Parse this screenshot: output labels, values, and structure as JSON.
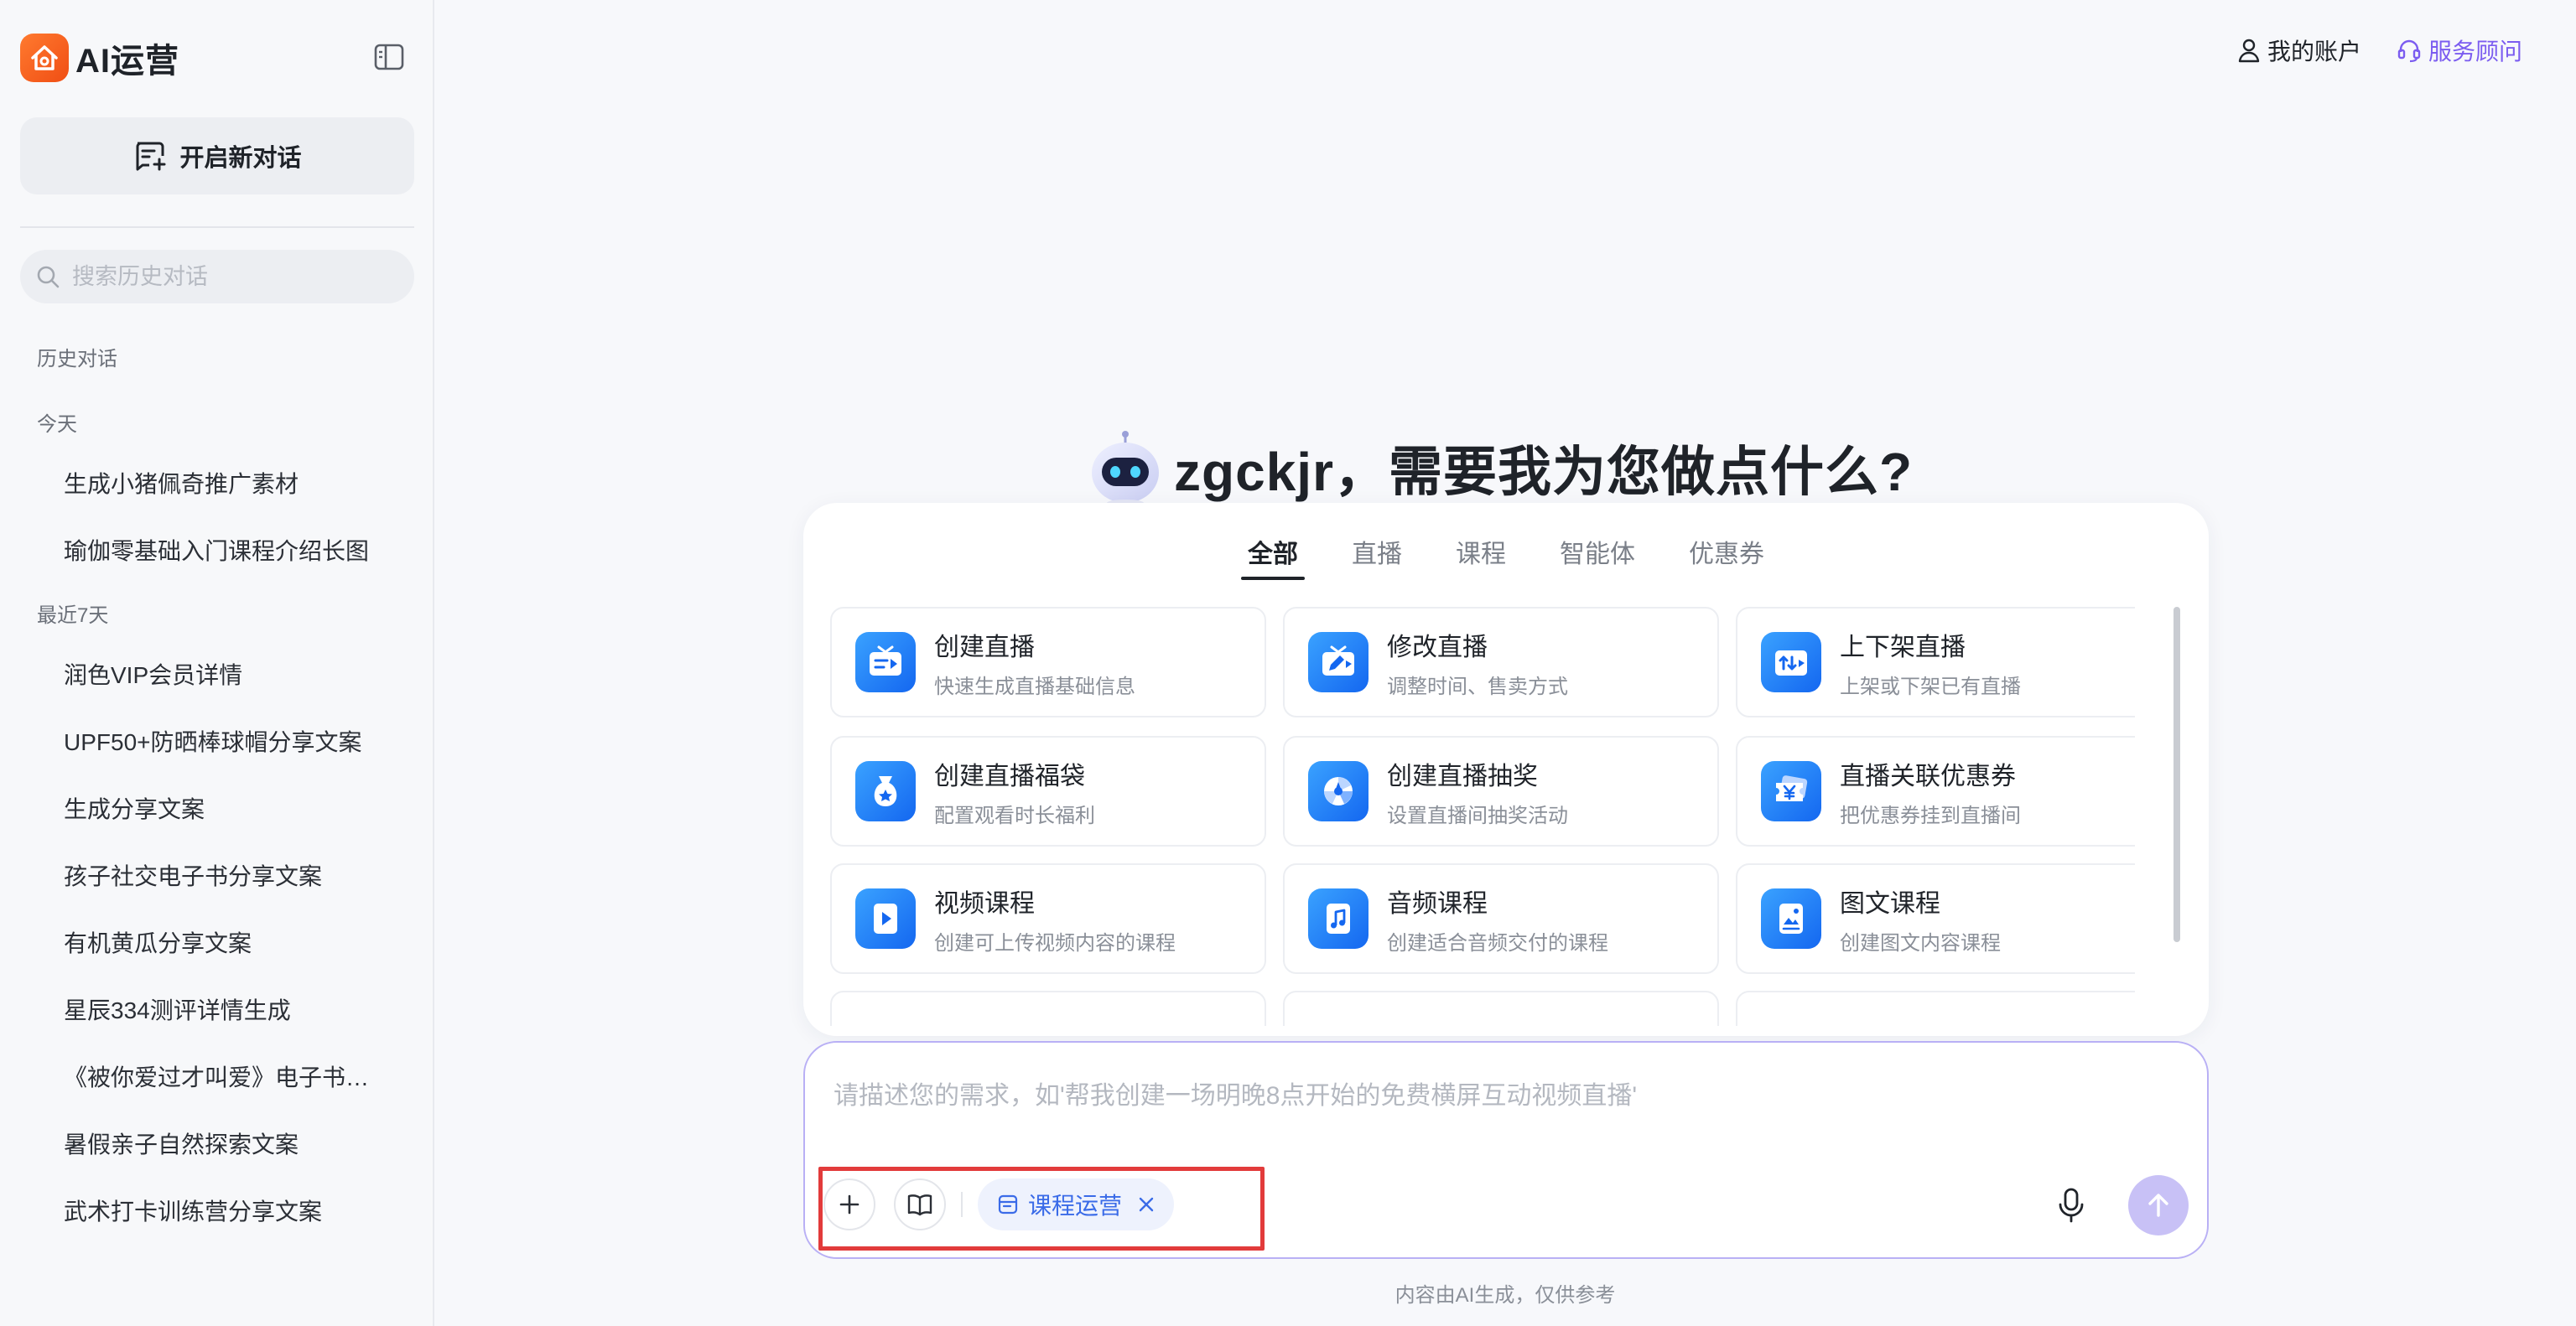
{
  "app": {
    "name": "AI运营"
  },
  "sidebar": {
    "new_chat_label": "开启新对话",
    "search_placeholder": "搜索历史对话",
    "history_heading": "历史对话",
    "sections": [
      {
        "label": "今天",
        "items": [
          "生成小猪佩奇推广素材",
          "瑜伽零基础入门课程介绍长图"
        ]
      },
      {
        "label": "最近7天",
        "items": [
          "润色VIP会员详情",
          "UPF50+防晒棒球帽分享文案",
          "生成分享文案",
          "孩子社交电子书分享文案",
          "有机黄瓜分享文案",
          "星辰334测评详情生成",
          "《被你爱过才叫爱》电子书分享文案",
          "暑假亲子自然探索文案",
          "武术打卡训练营分享文案"
        ]
      }
    ]
  },
  "header": {
    "account_label": "我的账户",
    "advisor_label": "服务顾问"
  },
  "greeting": "zgckjr，需要我为您做点什么?",
  "tabs": [
    {
      "label": "全部",
      "active": true
    },
    {
      "label": "直播",
      "active": false
    },
    {
      "label": "课程",
      "active": false
    },
    {
      "label": "智能体",
      "active": false
    },
    {
      "label": "优惠券",
      "active": false
    }
  ],
  "cards": [
    {
      "title": "创建直播",
      "desc": "快速生成直播基础信息",
      "icon": "live-create-icon"
    },
    {
      "title": "修改直播",
      "desc": "调整时间、售卖方式",
      "icon": "live-edit-icon"
    },
    {
      "title": "上下架直播",
      "desc": "上架或下架已有直播",
      "icon": "live-shelf-icon"
    },
    {
      "title": "创建直播福袋",
      "desc": "配置观看时长福利",
      "icon": "lucky-bag-icon"
    },
    {
      "title": "创建直播抽奖",
      "desc": "设置直播间抽奖活动",
      "icon": "lottery-icon"
    },
    {
      "title": "直播关联优惠券",
      "desc": "把优惠券挂到直播间",
      "icon": "coupon-icon"
    },
    {
      "title": "视频课程",
      "desc": "创建可上传视频内容的课程",
      "icon": "video-course-icon"
    },
    {
      "title": "音频课程",
      "desc": "创建适合音频交付的课程",
      "icon": "audio-course-icon"
    },
    {
      "title": "图文课程",
      "desc": "创建图文内容课程",
      "icon": "article-course-icon"
    }
  ],
  "input": {
    "placeholder": "请描述您的需求，如'帮我创建一场明晚8点开始的免费横屏互动视频直播'",
    "chip_label": "课程运营"
  },
  "footer_note": "内容由AI生成，仅供参考",
  "colors": {
    "accent": "#7b5cf0",
    "brand": "#f04e14",
    "card_icon": "#1467f0",
    "highlight": "#e23b3b"
  }
}
